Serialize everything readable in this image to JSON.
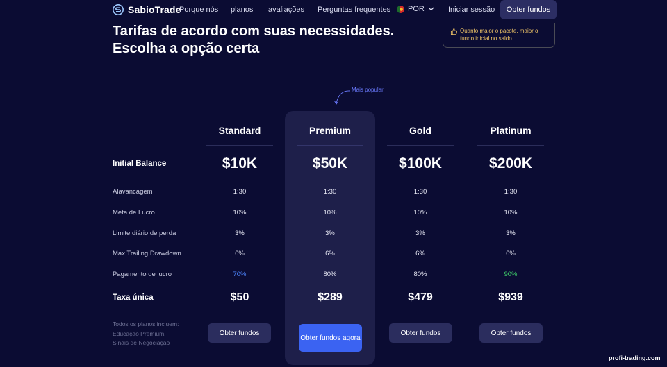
{
  "header": {
    "brand": "SabioTrade",
    "nav": [
      "Porque nós",
      "planos",
      "avaliações",
      "Perguntas frequentes"
    ],
    "language": "POR",
    "login": "Iniciar sessão",
    "cta": "Obter fundos"
  },
  "hero": {
    "title_line1": "Tarifas de acordo com suas necessidades.",
    "title_line2": "Escolha a opção certa",
    "note": "Quanto maior o pacote, maior o fundo inicial no saldo"
  },
  "popular_label": "Mais popular",
  "rows": {
    "initial_balance": "Initial Balance",
    "leverage": "Alavancagem",
    "profit_target": "Meta de Lucro",
    "daily_loss": "Limite diário de perda",
    "trailing_drawdown": "Max Trailing Drawdown",
    "profit_payout": "Pagamento de lucro",
    "one_time_fee": "Taxa única"
  },
  "plans": [
    {
      "name": "Standard",
      "balance": "$10K",
      "leverage": "1:30",
      "profit_target": "10%",
      "daily_loss": "3%",
      "drawdown": "6%",
      "payout": "70%",
      "fee": "$50",
      "button": "Obter fundos"
    },
    {
      "name": "Premium",
      "balance": "$50K",
      "leverage": "1:30",
      "profit_target": "10%",
      "daily_loss": "3%",
      "drawdown": "6%",
      "payout": "80%",
      "fee": "$289",
      "button": "Obter fundos agora"
    },
    {
      "name": "Gold",
      "balance": "$100K",
      "leverage": "1:30",
      "profit_target": "10%",
      "daily_loss": "3%",
      "drawdown": "6%",
      "payout": "80%",
      "fee": "$479",
      "button": "Obter fundos"
    },
    {
      "name": "Platinum",
      "balance": "$200K",
      "leverage": "1:30",
      "profit_target": "10%",
      "daily_loss": "3%",
      "drawdown": "6%",
      "payout": "90%",
      "fee": "$939",
      "button": "Obter fundos"
    }
  ],
  "includes": "Todos os planos incluem: Educação Premium, Sinais de Negociação",
  "watermark": "profi-trading.com",
  "colors": {
    "background": "#0b0c33",
    "accent": "#3b63f2",
    "payout_low": "#4d86ff",
    "payout_high": "#3fd06a",
    "note_text": "#f0c567"
  }
}
